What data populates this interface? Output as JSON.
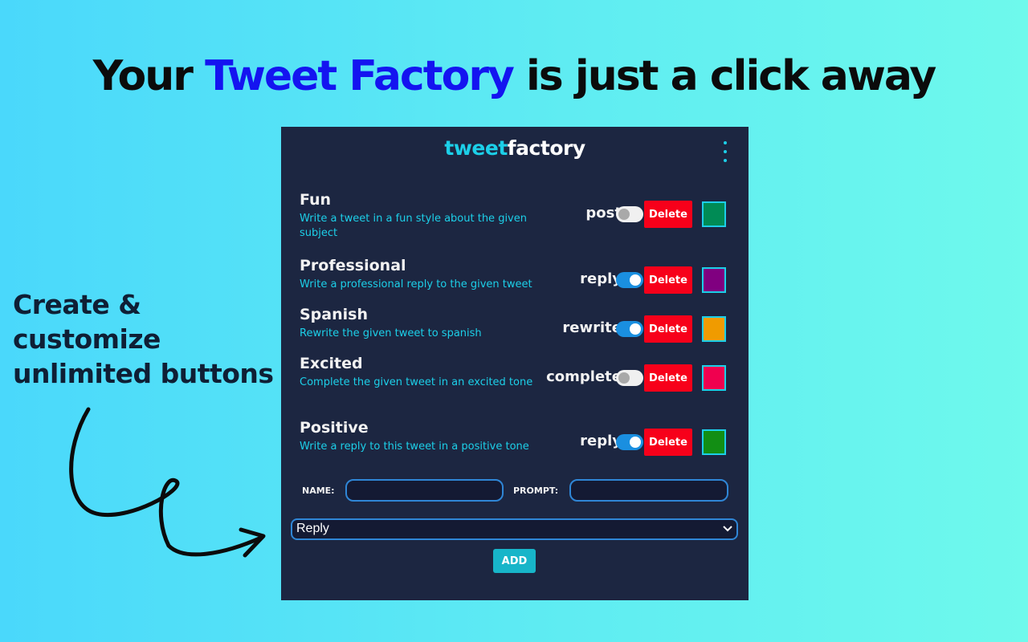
{
  "headline": {
    "before": "Your",
    "accent": "Tweet Factory",
    "after": "is just a click away",
    "accent_color": "#1414f0"
  },
  "side_text": {
    "line1": "Create &",
    "line2": "customize",
    "line3": "unlimited buttons"
  },
  "popup": {
    "logo_part1": "tweet",
    "logo_part2": "factory",
    "menu_icon": "kebab-menu-icon",
    "background": "#1c2641",
    "accent": "#1ccfe8"
  },
  "buttons": [
    {
      "name": "Fun",
      "description": "Write a tweet in a fun style about the given subject",
      "type": "post",
      "enabled": false,
      "delete_label": "Delete",
      "color": "#008b55"
    },
    {
      "name": "Professional",
      "description": "Write a professional reply to the given tweet",
      "type": "reply",
      "enabled": true,
      "delete_label": "Delete",
      "color": "#800080"
    },
    {
      "name": "Spanish",
      "description": "Rewrite the given tweet to spanish",
      "type": "rewrite",
      "enabled": true,
      "delete_label": "Delete",
      "color": "#f09b00"
    },
    {
      "name": "Excited",
      "description": "Complete the given tweet in an excited tone",
      "type": "complete",
      "enabled": false,
      "delete_label": "Delete",
      "color": "#f0004f"
    },
    {
      "name": "Positive",
      "description": "Write a reply to this tweet in a positive tone",
      "type": "reply",
      "enabled": true,
      "delete_label": "Delete",
      "color": "#128e14"
    }
  ],
  "form": {
    "name_label": "NAME:",
    "name_value": "",
    "prompt_label": "PROMPT:",
    "prompt_value": "",
    "select_value": "Reply",
    "add_label": "ADD"
  },
  "colors": {
    "delete": "#f7001a",
    "toggle_on": "#1a8fe0",
    "add": "#17b5c9"
  }
}
